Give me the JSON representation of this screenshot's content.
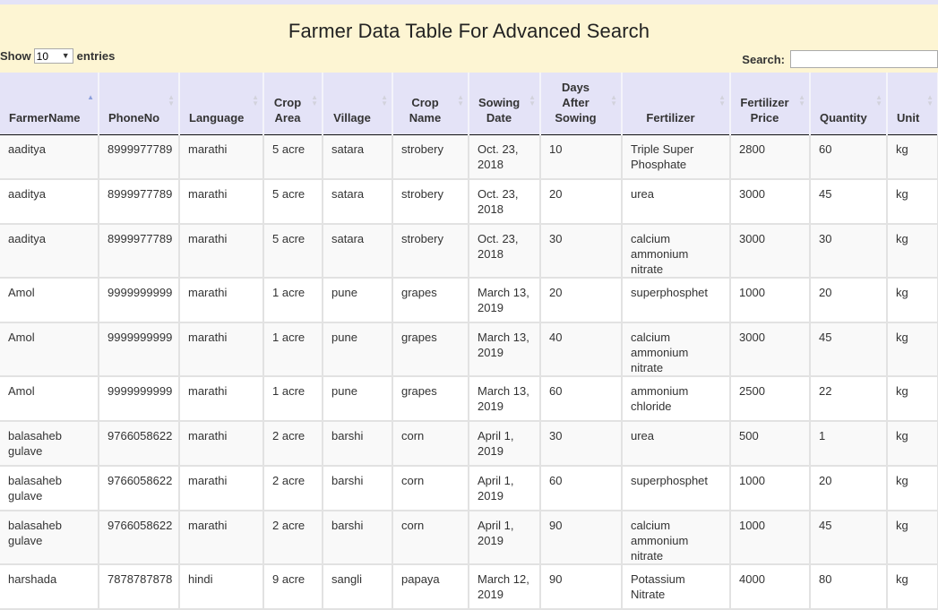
{
  "page": {
    "title": "Farmer Data Table For Advanced Search",
    "show_label": "Show",
    "entries_value": "10",
    "entries_label": "entries",
    "search_label": "Search:",
    "search_value": ""
  },
  "columns": [
    [
      "FarmerName"
    ],
    [
      "PhoneNo"
    ],
    [
      "Language"
    ],
    [
      "Crop",
      "Area"
    ],
    [
      "Village"
    ],
    [
      "Crop",
      "Name"
    ],
    [
      "Sowing",
      "Date"
    ],
    [
      "Days",
      "After",
      "Sowing"
    ],
    [
      "Fertilizer"
    ],
    [
      "Fertilizer",
      "Price"
    ],
    [
      "Quantity"
    ],
    [
      "Unit"
    ]
  ],
  "rows": [
    [
      "aaditya",
      "8999977789",
      "marathi",
      "5 acre",
      "satara",
      "strobery",
      "Oct. 23, 2018",
      "10",
      "Triple Super Phosphate",
      "2800",
      "60",
      "kg"
    ],
    [
      "aaditya",
      "8999977789",
      "marathi",
      "5 acre",
      "satara",
      "strobery",
      "Oct. 23, 2018",
      "20",
      "urea",
      "3000",
      "45",
      "kg"
    ],
    [
      "aaditya",
      "8999977789",
      "marathi",
      "5 acre",
      "satara",
      "strobery",
      "Oct. 23, 2018",
      "30",
      "calcium ammonium nitrate",
      "3000",
      "30",
      "kg"
    ],
    [
      "Amol",
      "9999999999",
      "marathi",
      "1 acre",
      "pune",
      "grapes",
      "March 13, 2019",
      "20",
      "superphosphet",
      "1000",
      "20",
      "kg"
    ],
    [
      "Amol",
      "9999999999",
      "marathi",
      "1 acre",
      "pune",
      "grapes",
      "March 13, 2019",
      "40",
      "calcium ammonium nitrate",
      "3000",
      "45",
      "kg"
    ],
    [
      "Amol",
      "9999999999",
      "marathi",
      "1 acre",
      "pune",
      "grapes",
      "March 13, 2019",
      "60",
      "ammonium chloride",
      "2500",
      "22",
      "kg"
    ],
    [
      "balasaheb gulave",
      "9766058622",
      "marathi",
      "2 acre",
      "barshi",
      "corn",
      "April 1, 2019",
      "30",
      "urea",
      "500",
      "1",
      "kg"
    ],
    [
      "balasaheb gulave",
      "9766058622",
      "marathi",
      "2 acre",
      "barshi",
      "corn",
      "April 1, 2019",
      "60",
      "superphosphet",
      "1000",
      "20",
      "kg"
    ],
    [
      "balasaheb gulave",
      "9766058622",
      "marathi",
      "2 acre",
      "barshi",
      "corn",
      "April 1, 2019",
      "90",
      "calcium ammonium nitrate",
      "1000",
      "45",
      "kg"
    ],
    [
      "harshada",
      "7878787878",
      "hindi",
      "9 acre",
      "sangli",
      "papaya",
      "March 12, 2019",
      "90",
      "Potassium Nitrate",
      "4000",
      "80",
      "kg"
    ]
  ],
  "sort": {
    "column": 0,
    "direction": "ascending"
  },
  "colors": {
    "header_bg": "#fdf5d3",
    "table_head_bg": "#e4e3f7",
    "sort_active": "#8c9fdc"
  }
}
